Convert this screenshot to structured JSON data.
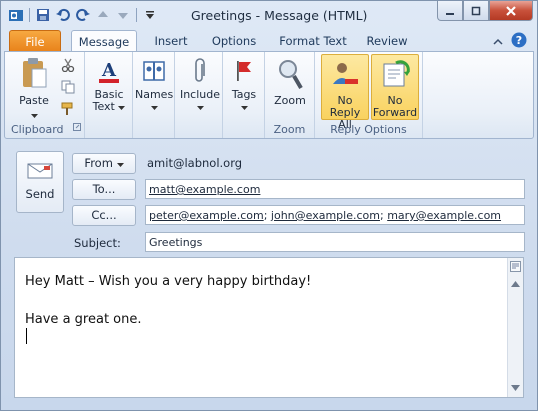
{
  "window": {
    "title": "Greetings - Message (HTML)"
  },
  "tabs": {
    "file": "File",
    "message": "Message",
    "insert": "Insert",
    "options": "Options",
    "format_text": "Format Text",
    "review": "Review"
  },
  "ribbon": {
    "clipboard": {
      "label": "Clipboard",
      "paste": "Paste"
    },
    "basic_text": {
      "line1": "Basic",
      "line2": "Text"
    },
    "names": "Names",
    "include": "Include",
    "tags": "Tags",
    "zoom": {
      "label": "Zoom",
      "button": "Zoom"
    },
    "reply_options": {
      "label": "Reply Options",
      "no_reply_all_1": "No",
      "no_reply_all_2": "Reply All",
      "no_forward_1": "No",
      "no_forward_2": "Forward"
    }
  },
  "compose": {
    "send": "Send",
    "from_button": "From",
    "from_address": "amit@labnol.org",
    "to_button": "To...",
    "to": [
      "matt@example.com"
    ],
    "cc_button": "Cc...",
    "cc": [
      "peter@example.com",
      "john@example.com",
      "mary@example.com"
    ],
    "subject_label": "Subject:",
    "subject": "Greetings"
  },
  "message_body": {
    "line1": "Hey Matt – Wish you a very happy birthday!",
    "line2": "Have a great one."
  },
  "colors": {
    "file_tab": "#e8811a",
    "highlight": "#f9d25f",
    "ribbon_bg": "#eaf0f8"
  }
}
